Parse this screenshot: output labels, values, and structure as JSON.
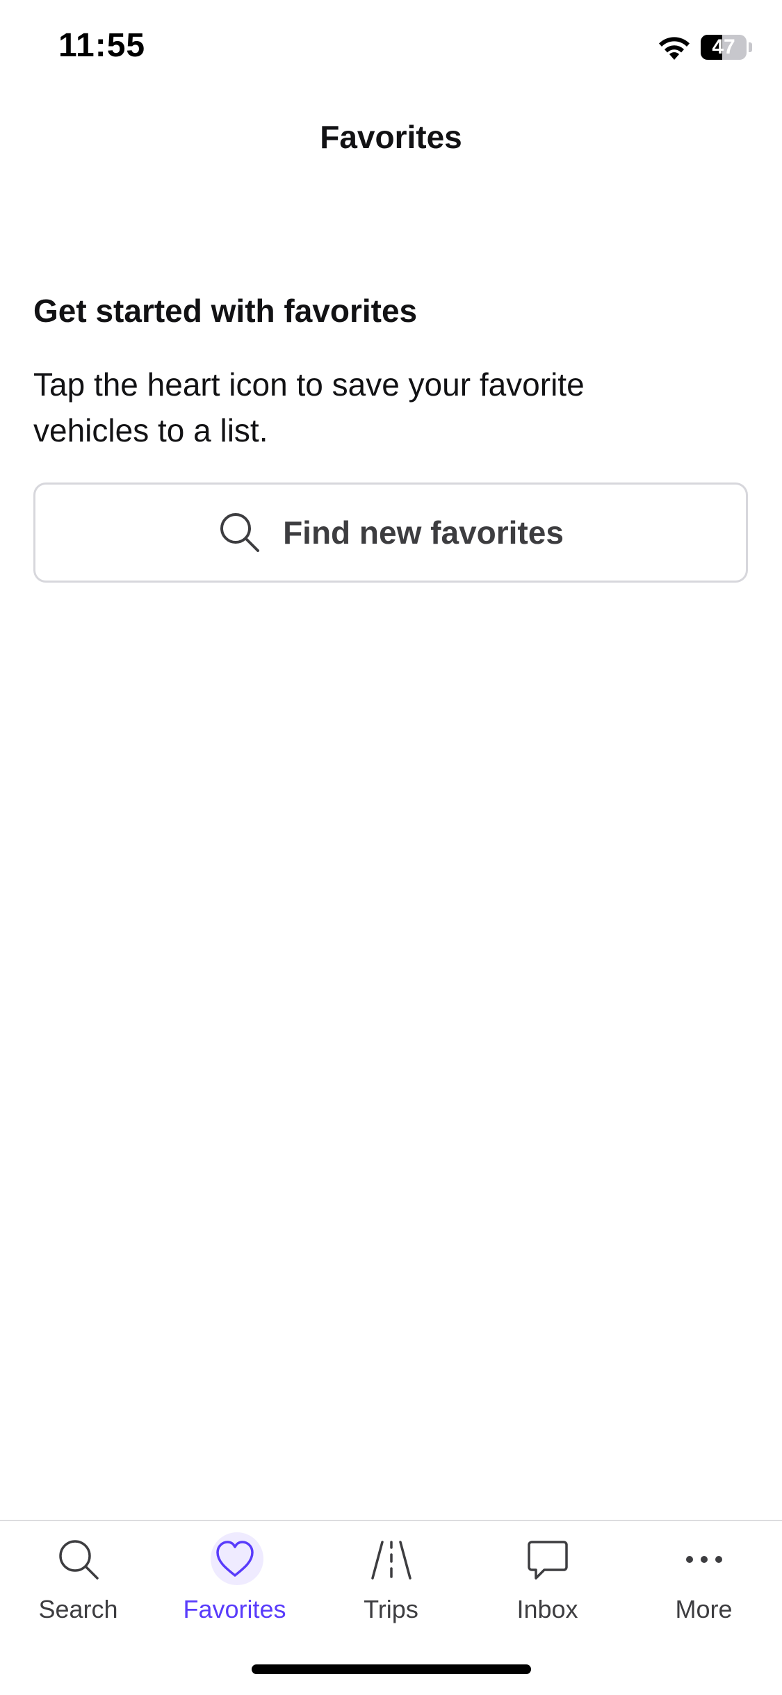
{
  "status_bar": {
    "time": "11:55",
    "battery_level": "47",
    "battery_fraction": 0.47,
    "wifi_icon": "wifi-icon"
  },
  "header": {
    "title": "Favorites"
  },
  "empty_state": {
    "heading": "Get started with favorites",
    "body": "Tap the heart icon to save your favorite vehicles to a list.",
    "button_label": "Find new favorites",
    "button_icon": "search-icon"
  },
  "tab_bar": {
    "active_color": "#593cfb",
    "items": [
      {
        "label": "Search",
        "icon": "search-icon"
      },
      {
        "label": "Favorites",
        "icon": "heart-icon",
        "active": true
      },
      {
        "label": "Trips",
        "icon": "road-icon"
      },
      {
        "label": "Inbox",
        "icon": "chat-bubble-icon"
      },
      {
        "label": "More",
        "icon": "more-dots-icon"
      }
    ]
  }
}
